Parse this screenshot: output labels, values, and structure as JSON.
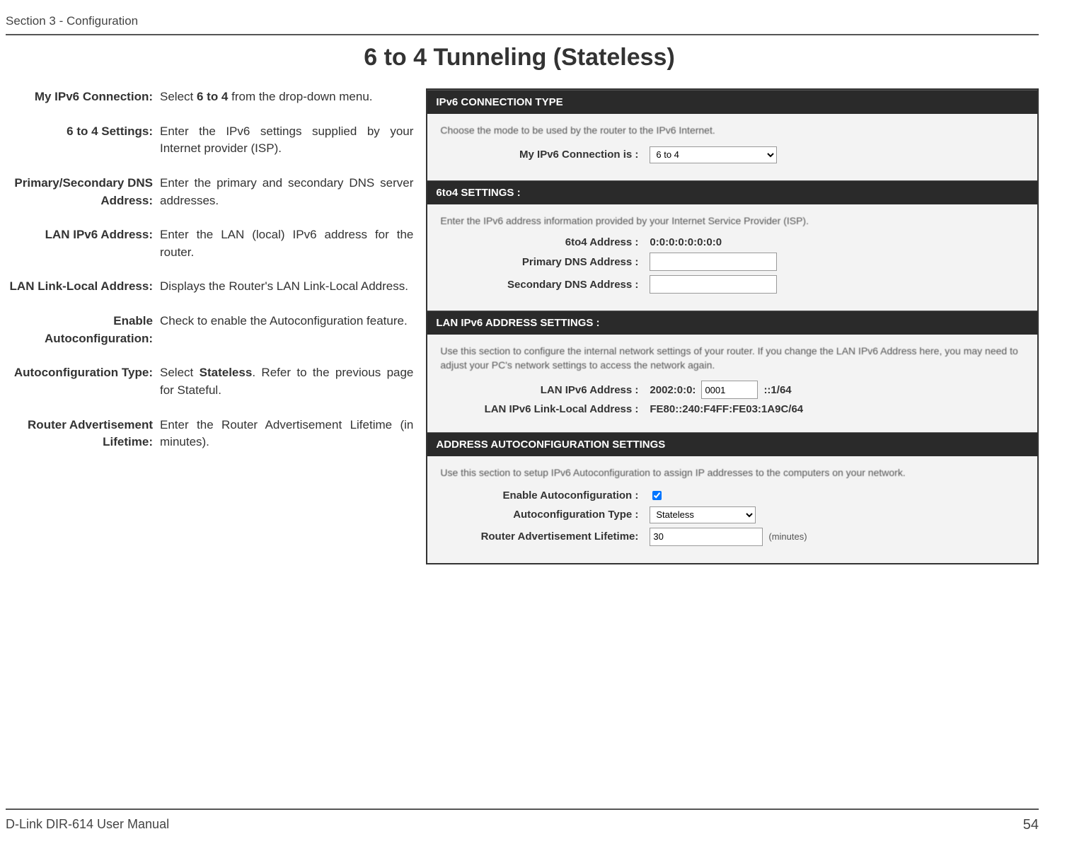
{
  "header": {
    "section": "Section 3 - Configuration"
  },
  "title": "6 to 4 Tunneling (Stateless)",
  "defs": [
    {
      "label": "My IPv6 Connection:",
      "value": "Select <b>6 to 4</b> from the drop-down menu."
    },
    {
      "label": "6 to 4 Settings:",
      "value": "Enter the IPv6 settings supplied by your Internet provider (ISP)."
    },
    {
      "label": "Primary/Secondary DNS Address:",
      "value": "Enter the primary and secondary DNS server addresses."
    },
    {
      "label": "LAN IPv6 Address:",
      "value": "Enter the LAN (local) IPv6 address for the router."
    },
    {
      "label": "LAN Link-Local Address:",
      "value": "Displays the Router's LAN Link-Local Address."
    },
    {
      "label": "Enable Autoconfiguration:",
      "value": "Check to enable the Autoconfiguration feature."
    },
    {
      "label": "Autoconfiguration Type:",
      "value": "Select <b>Stateless</b>. Refer to the previous page for Stateful."
    },
    {
      "label": "Router Advertisement Lifetime:",
      "value": "Enter the Router Advertisement Lifetime (in minutes)."
    }
  ],
  "shot": {
    "s1": {
      "title": "IPv6 CONNECTION TYPE",
      "desc": "Choose the mode to be used by the router to the IPv6 Internet.",
      "label": "My IPv6 Connection is :",
      "value": "6 to 4"
    },
    "s2": {
      "title": "6to4 SETTINGS :",
      "desc": "Enter the IPv6 address information provided by your Internet Service Provider (ISP).",
      "addr_label": "6to4 Address :",
      "addr_value": "0:0:0:0:0:0:0:0",
      "pdns_label": "Primary DNS Address :",
      "sdns_label": "Secondary DNS Address :"
    },
    "s3": {
      "title": "LAN IPv6 ADDRESS SETTINGS :",
      "desc": "Use this section to configure the internal network settings of your router. If you change the LAN IPv6 Address here, you may need to adjust your PC's network settings to access the network again.",
      "lan_label": "LAN IPv6 Address :",
      "lan_prefix": "2002:0:0:",
      "lan_value": "0001",
      "lan_suffix": "::1/64",
      "ll_label": "LAN IPv6 Link-Local Address :",
      "ll_value": "FE80::240:F4FF:FE03:1A9C/64"
    },
    "s4": {
      "title": "ADDRESS AUTOCONFIGURATION SETTINGS",
      "desc": "Use this section to setup IPv6 Autoconfiguration to assign IP addresses to the computers on your network.",
      "en_label": "Enable Autoconfiguration :",
      "type_label": "Autoconfiguration Type :",
      "type_value": "Stateless",
      "life_label": "Router Advertisement Lifetime:",
      "life_value": "30",
      "life_unit": "(minutes)"
    }
  },
  "footer": {
    "product": "D-Link DIR-614 User Manual",
    "page": "54"
  }
}
